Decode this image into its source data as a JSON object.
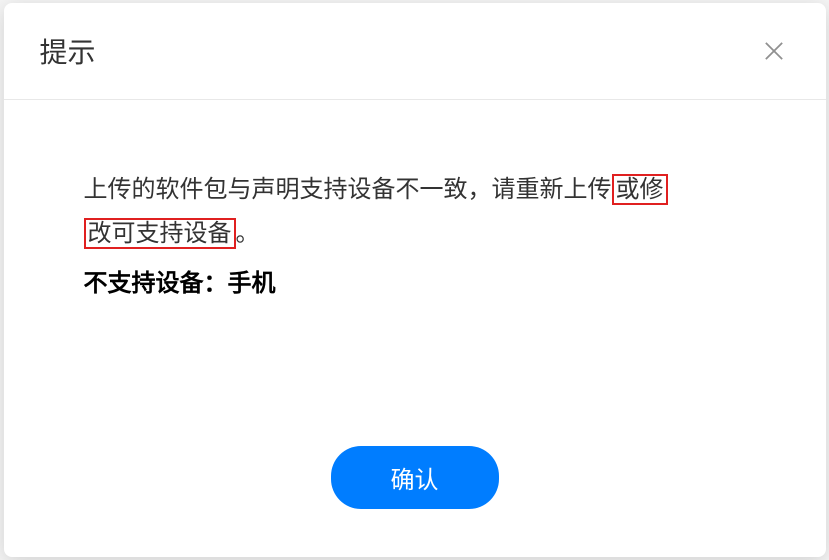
{
  "dialog": {
    "title": "提示",
    "message_part1": "上传的软件包与声明支持设备不一致，请重新上传",
    "message_highlight1": "或修",
    "message_highlight2": "改可支持设备",
    "message_part2": "。",
    "unsupported_label": "不支持设备：",
    "unsupported_device": "手机",
    "confirm_label": "确认",
    "highlight_color": "#e02020",
    "primary_color": "#007dff"
  }
}
